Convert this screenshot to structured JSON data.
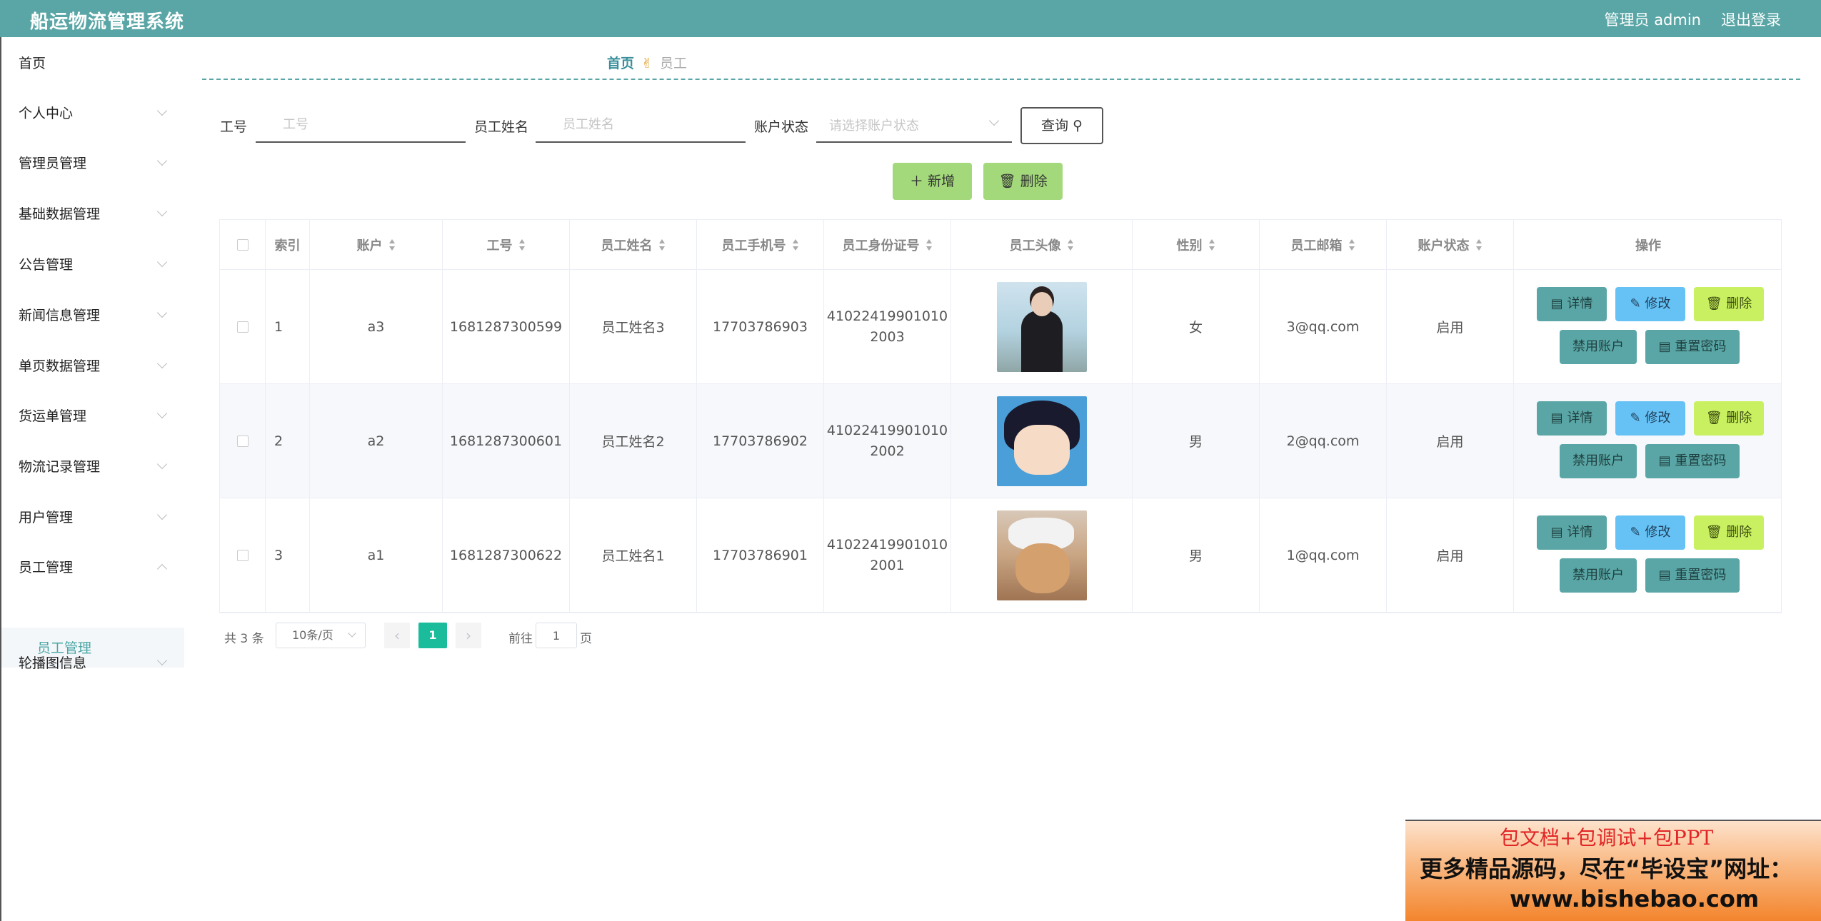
{
  "header": {
    "title": "船运物流管理系统",
    "user_label": "管理员 admin",
    "logout_label": "退出登录",
    "color": "#5aa6a6"
  },
  "sidebar": {
    "items": [
      {
        "label": "首页"
      },
      {
        "label": "个人中心"
      },
      {
        "label": "管理员管理"
      },
      {
        "label": "基础数据管理"
      },
      {
        "label": "公告管理"
      },
      {
        "label": "新闻信息管理"
      },
      {
        "label": "单页数据管理"
      },
      {
        "label": "货运单管理"
      },
      {
        "label": "物流记录管理"
      },
      {
        "label": "用户管理"
      },
      {
        "label": "员工管理"
      },
      {
        "label": "轮播图信息"
      }
    ],
    "submenu_active": "员工管理"
  },
  "breadcrumb": {
    "home": "首页",
    "current": "员工"
  },
  "search": {
    "job_no_label": "工号",
    "job_no_placeholder": "工号",
    "name_label": "员工姓名",
    "name_placeholder": "员工姓名",
    "status_label": "账户状态",
    "status_placeholder": "请选择账户状态",
    "query_label": "查询"
  },
  "actions": {
    "add_label": "新增",
    "delete_label": "删除"
  },
  "table": {
    "headers": {
      "index": "索引",
      "account": "账户",
      "job_no": "工号",
      "name": "员工姓名",
      "phone": "员工手机号",
      "id_card": "员工身份证号",
      "avatar": "员工头像",
      "gender": "性别",
      "email": "员工邮箱",
      "status": "账户状态",
      "ops": "操作"
    },
    "rows": [
      {
        "index": "1",
        "account": "a3",
        "job_no": "1681287300599",
        "name": "员工姓名3",
        "phone": "17703786903",
        "id_line1": "41022419901010",
        "id_line2": "2003",
        "gender": "女",
        "email": "3@qq.com",
        "status": "启用"
      },
      {
        "index": "2",
        "account": "a2",
        "job_no": "1681287300601",
        "name": "员工姓名2",
        "phone": "17703786902",
        "id_line1": "41022419901010",
        "id_line2": "2002",
        "gender": "男",
        "email": "2@qq.com",
        "status": "启用"
      },
      {
        "index": "3",
        "account": "a1",
        "job_no": "1681287300622",
        "name": "员工姓名1",
        "phone": "17703786901",
        "id_line1": "41022419901010",
        "id_line2": "2001",
        "gender": "男",
        "email": "1@qq.com",
        "status": "启用"
      }
    ],
    "row_actions": {
      "detail": "详情",
      "edit": "修改",
      "remove": "删除",
      "ban": "禁用账户",
      "reset": "重置密码"
    }
  },
  "pagination": {
    "total": "共 3 条",
    "page_size": "10条/页",
    "current_page": "1",
    "goto_label": "前往",
    "goto_value": "1",
    "page_suffix": "页"
  },
  "banner": {
    "line1": "包文档+包调试+包PPT",
    "line2": "更多精品源码，尽在“毕设宝”网址：",
    "line3": "www.bishebao.com"
  }
}
